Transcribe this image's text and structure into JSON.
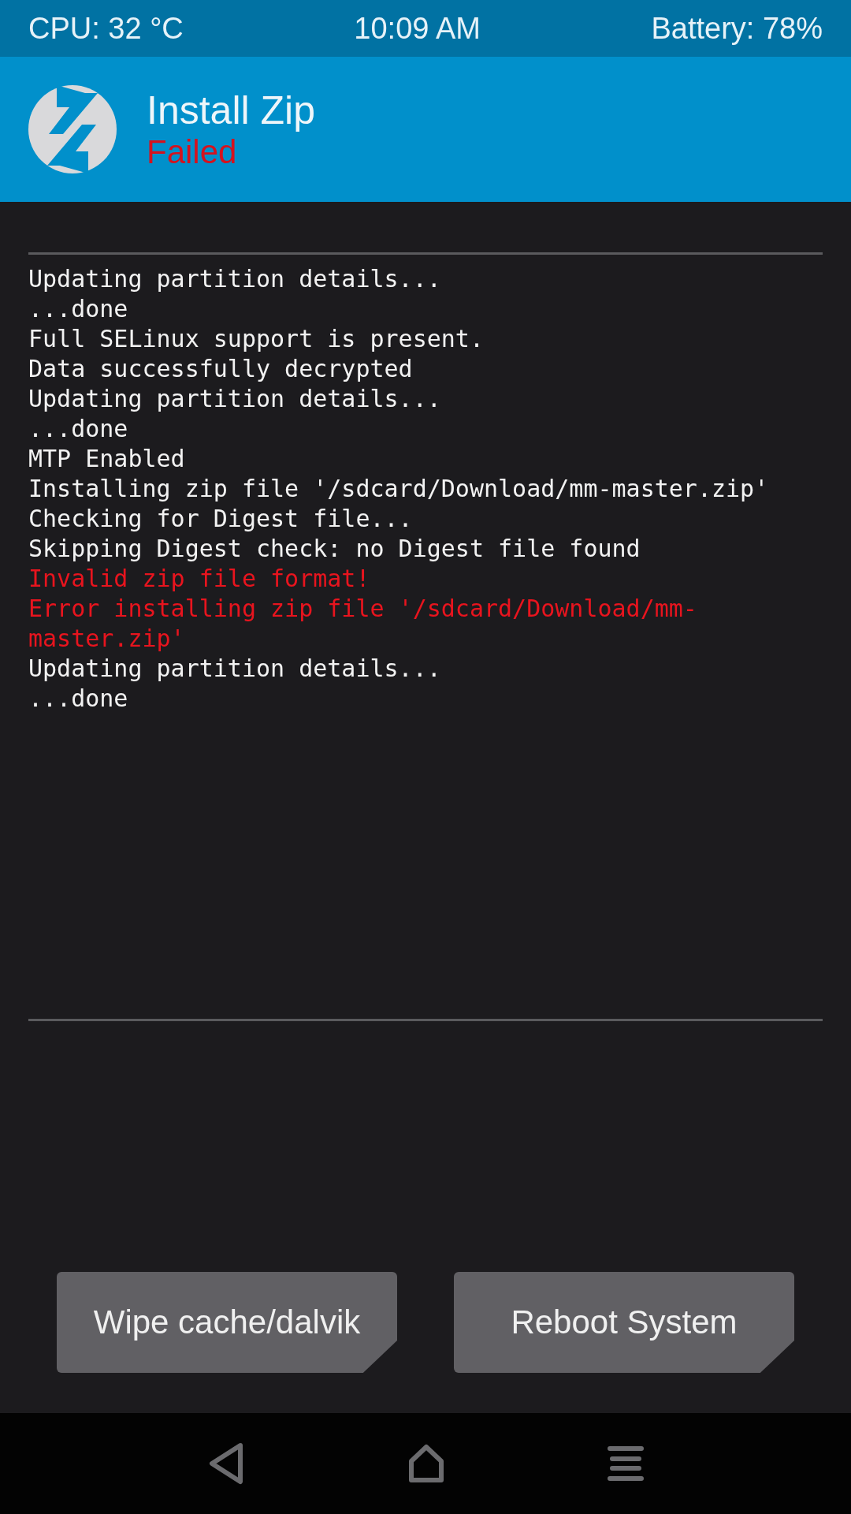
{
  "status_bar": {
    "cpu": "CPU: 32 °C",
    "time": "10:09 AM",
    "battery": "Battery: 78%"
  },
  "header": {
    "title": "Install Zip",
    "status": "Failed",
    "failed": true
  },
  "console": [
    {
      "text": "Updating partition details...",
      "kind": "info"
    },
    {
      "text": "...done",
      "kind": "info"
    },
    {
      "text": "Full SELinux support is present.",
      "kind": "info"
    },
    {
      "text": "Data successfully decrypted",
      "kind": "info"
    },
    {
      "text": "Updating partition details...",
      "kind": "info"
    },
    {
      "text": "...done",
      "kind": "info"
    },
    {
      "text": "MTP Enabled",
      "kind": "info"
    },
    {
      "text": "Installing zip file '/sdcard/Download/mm-master.zip'",
      "kind": "info"
    },
    {
      "text": "Checking for Digest file...",
      "kind": "info"
    },
    {
      "text": "Skipping Digest check: no Digest file found",
      "kind": "info"
    },
    {
      "text": "Invalid zip file format!",
      "kind": "error"
    },
    {
      "text": "Error installing zip file '/sdcard/Download/mm-master.zip'",
      "kind": "error"
    },
    {
      "text": "Updating partition details...",
      "kind": "info"
    },
    {
      "text": "...done",
      "kind": "info"
    }
  ],
  "buttons": [
    "Wipe cache/dalvik",
    "Reboot System"
  ]
}
